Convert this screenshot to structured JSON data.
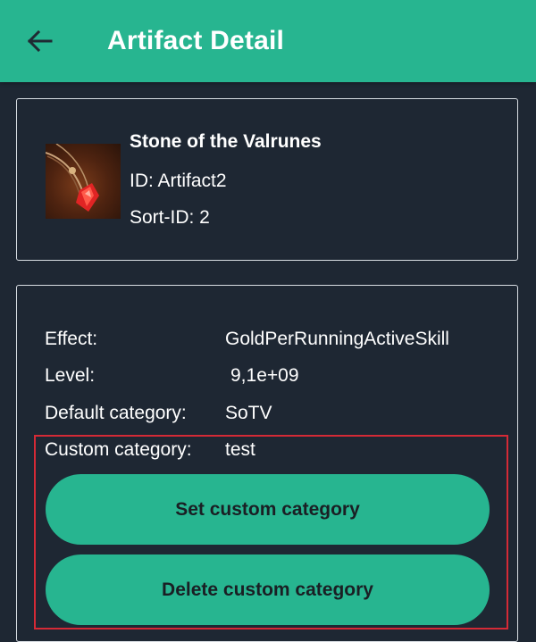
{
  "appbar": {
    "title": "Artifact Detail",
    "back_icon": "arrow-left-icon"
  },
  "artifact": {
    "name": "Stone of the Valrunes",
    "id_text": "ID: Artifact2",
    "sort_id_text": "Sort-ID: 2",
    "image_icon": "red-gem-pendant-image"
  },
  "details": {
    "effect_label": "Effect:",
    "effect_value": "GoldPerRunningActiveSkill",
    "level_label": "Level:",
    "level_value": "9,1e+09",
    "default_category_label": "Default category:",
    "default_category_value": "SoTV",
    "custom_category_label": "Custom category:",
    "custom_category_value": "test"
  },
  "actions": {
    "set_label": "Set custom category",
    "delete_label": "Delete custom category"
  },
  "colors": {
    "accent": "#27b590",
    "background": "#1e2733",
    "highlight": "#d42a36"
  }
}
